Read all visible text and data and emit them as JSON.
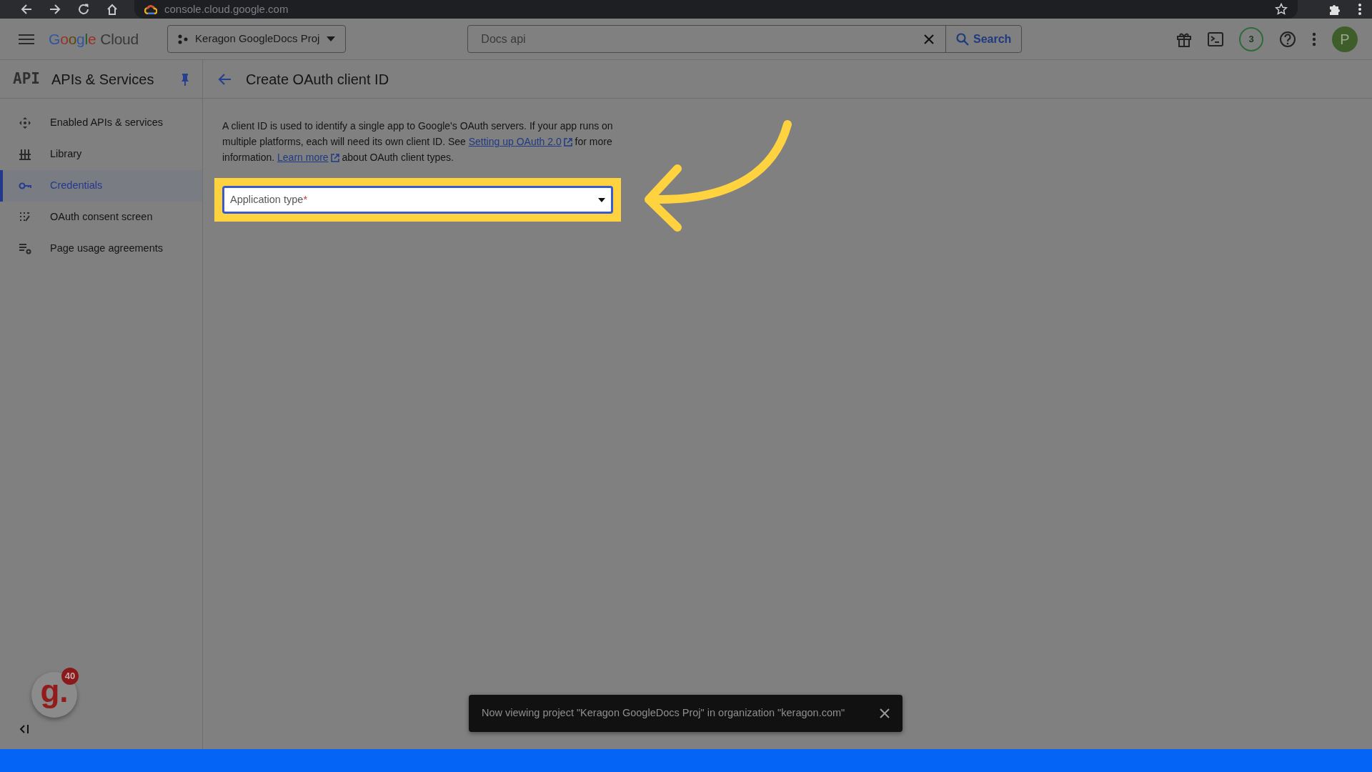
{
  "browser": {
    "url": "console.cloud.google.com"
  },
  "header": {
    "logo": "Google Cloud",
    "project": "Keragon GoogleDocs Proj",
    "search": {
      "value": "Docs api",
      "button": "Search"
    },
    "notifications": "3",
    "avatar": "P"
  },
  "sidebar": {
    "badge": "API",
    "title": "APIs & Services",
    "items": [
      {
        "label": "Enabled APIs & services",
        "selected": false
      },
      {
        "label": "Library",
        "selected": false
      },
      {
        "label": "Credentials",
        "selected": true
      },
      {
        "label": "OAuth consent screen",
        "selected": false
      },
      {
        "label": "Page usage agreements",
        "selected": false
      }
    ]
  },
  "page": {
    "title": "Create OAuth client ID",
    "description": [
      {
        "kind": "text",
        "text": "A client ID is used to identify a single app to Google's OAuth servers. If your app runs on multiple platforms, each will need its own client ID. See "
      },
      {
        "kind": "link",
        "text": "Setting up OAuth 2.0"
      },
      {
        "kind": "text",
        "text": " for more information. "
      },
      {
        "kind": "link",
        "text": "Learn more"
      },
      {
        "kind": "text",
        "text": " about OAuth client types."
      }
    ],
    "field": {
      "label": "Application type",
      "required_mark": "*"
    }
  },
  "widget": {
    "logo": "g.",
    "count": "40"
  },
  "snackbar": {
    "message": "Now viewing project \"Keragon GoogleDocs Proj\" in organization \"keragon.com\""
  }
}
